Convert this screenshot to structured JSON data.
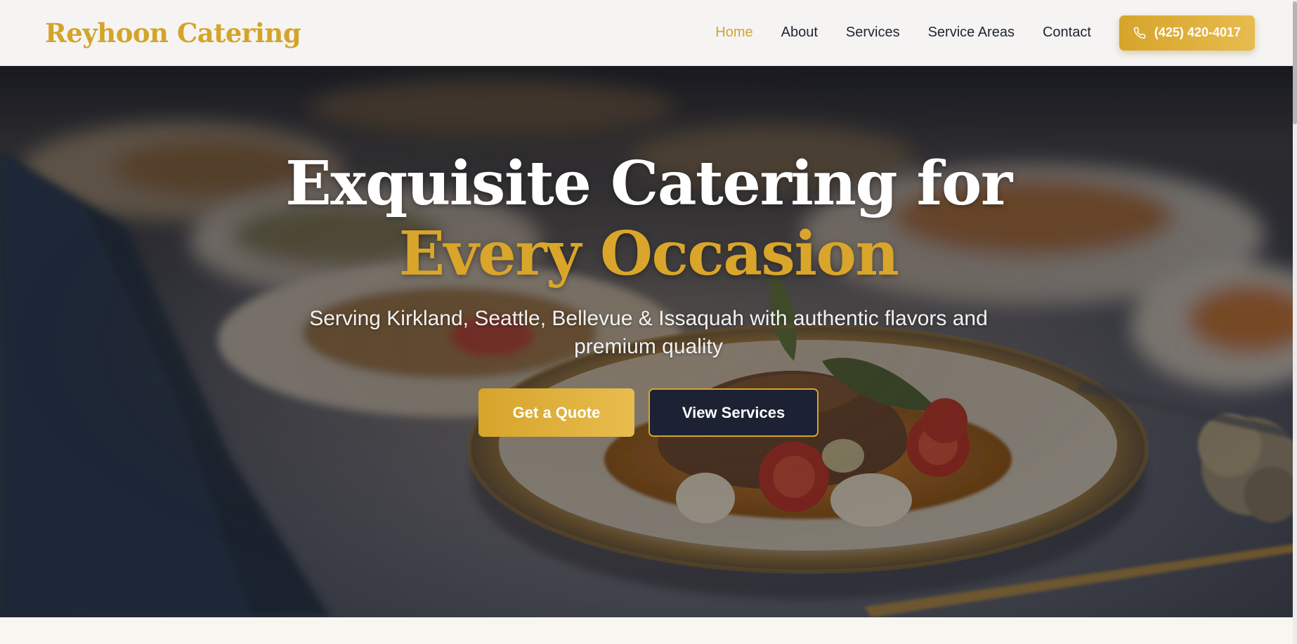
{
  "brand": {
    "name": "Reyhoon Catering"
  },
  "nav": {
    "items": [
      {
        "label": "Home",
        "active": true
      },
      {
        "label": "About",
        "active": false
      },
      {
        "label": "Services",
        "active": false
      },
      {
        "label": "Service Areas",
        "active": false
      },
      {
        "label": "Contact",
        "active": false
      }
    ],
    "phone": {
      "label": "(425) 420-4017",
      "icon": "phone-icon"
    }
  },
  "hero": {
    "headline_line1": "Exquisite Catering for",
    "headline_line2": "Every Occasion",
    "subline_line1": "Serving Kirkland, Seattle, Bellevue & Issaquah with authentic flavors and",
    "subline_line2": "premium quality",
    "buttons": {
      "quote": "Get a Quote",
      "services": "View Services"
    }
  },
  "colors": {
    "accent": "#d4a42a",
    "navy": "#1c2233",
    "nav_text": "#1f2433",
    "background": "#f8f6f1"
  }
}
